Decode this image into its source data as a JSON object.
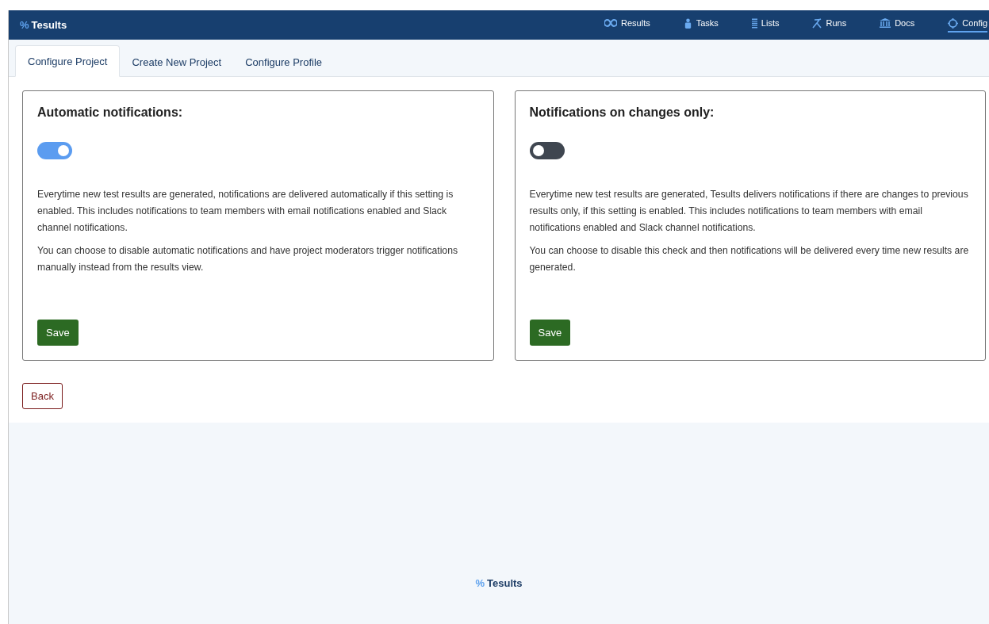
{
  "header": {
    "logo_mark": "%",
    "logo_text": "Tesults",
    "nav": [
      {
        "kind": "infinity",
        "label": "Results",
        "selected": false
      },
      {
        "kind": "person",
        "label": "Tasks",
        "selected": false
      },
      {
        "kind": "stack",
        "label": "Lists",
        "selected": false
      },
      {
        "kind": "runner",
        "label": "Runs",
        "selected": false
      },
      {
        "kind": "bank",
        "label": "Docs",
        "selected": false
      },
      {
        "kind": "gear",
        "label": "Config",
        "selected": true
      }
    ]
  },
  "tabs": [
    {
      "label": "Configure Project",
      "selected": true
    },
    {
      "label": "Create New Project",
      "selected": false
    },
    {
      "label": "Configure Profile",
      "selected": false
    }
  ],
  "cards": [
    {
      "title": "Automatic notifications:",
      "on": true,
      "paragraphs": [
        "Everytime new test results are generated, notifications are delivered automatically if this setting is enabled. This includes notifications to team members with email notifications enabled and Slack channel notifications.",
        "You can choose to disable automatic notifications and have project moderators trigger notifications manually instead from the results view."
      ],
      "button": "Save"
    },
    {
      "title": "Notifications on changes only:",
      "on": false,
      "paragraphs": [
        "Everytime new test results are generated, Tesults delivers notifications if there are changes to previous results only, if this setting is enabled. This includes notifications to team members with email notifications enabled and Slack channel notifications.",
        "You can choose to disable this check and then notifications will be delivered every time new results are generated."
      ],
      "button": "Save"
    }
  ],
  "back_button": "Back",
  "footer": {
    "logo_mark": "%",
    "logo_text": "Tesults"
  }
}
